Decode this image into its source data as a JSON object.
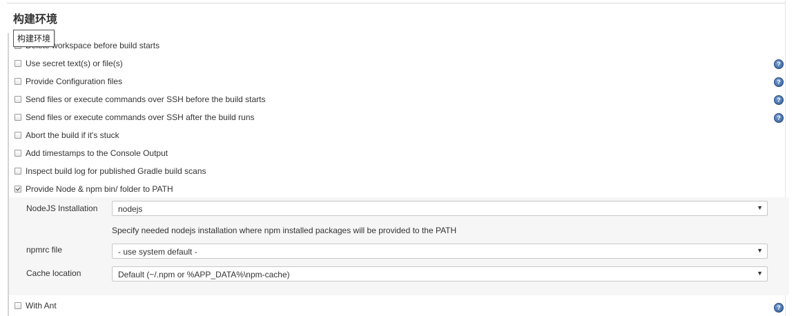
{
  "section": {
    "title": "构建环境",
    "tooltip": "构建环境"
  },
  "options": [
    {
      "label": "Delete workspace before build starts",
      "checked": false,
      "help": false
    },
    {
      "label": "Use secret text(s) or file(s)",
      "checked": false,
      "help": true
    },
    {
      "label": "Provide Configuration files",
      "checked": false,
      "help": true
    },
    {
      "label": "Send files or execute commands over SSH before the build starts",
      "checked": false,
      "help": true
    },
    {
      "label": "Send files or execute commands over SSH after the build runs",
      "checked": false,
      "help": true
    },
    {
      "label": "Abort the build if it's stuck",
      "checked": false,
      "help": false
    },
    {
      "label": "Add timestamps to the Console Output",
      "checked": false,
      "help": false
    },
    {
      "label": "Inspect build log for published Gradle build scans",
      "checked": false,
      "help": false
    },
    {
      "label": "Provide Node & npm bin/ folder to PATH",
      "checked": true,
      "help": false
    },
    {
      "label": "With Ant",
      "checked": false,
      "help": true
    }
  ],
  "node": {
    "installation_label": "NodeJS Installation",
    "installation_value": "nodejs",
    "installation_desc": "Specify needed nodejs installation where npm installed packages will be provided to the PATH",
    "npmrc_label": "npmrc file",
    "npmrc_value": "- use system default -",
    "cache_label": "Cache location",
    "cache_value": "Default (~/.npm or %APP_DATA%\\npm-cache)"
  },
  "icons": {
    "help": "help-icon",
    "dropdown": "chevron-down-icon",
    "help_glyph": "?",
    "dropdown_glyph": "▼"
  },
  "colors": {
    "help_icon": "#2d5c9a",
    "nested_panel_bg": "#f6f6f6",
    "text": "#333333"
  }
}
